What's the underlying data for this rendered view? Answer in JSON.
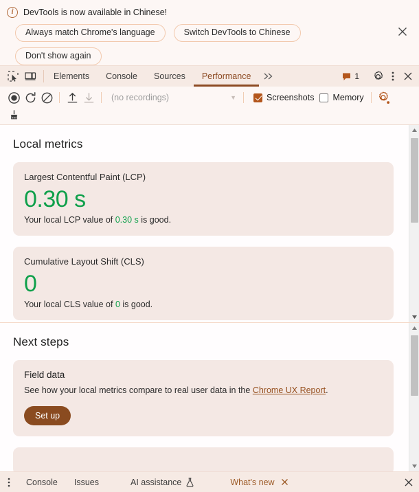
{
  "banner": {
    "icon": "info-circle-icon",
    "title": "DevTools is now available in Chinese!",
    "buttons": [
      {
        "label": "Always match Chrome's language",
        "name": "always-match-language-button"
      },
      {
        "label": "Switch DevTools to Chinese",
        "name": "switch-to-chinese-button"
      },
      {
        "label": "Don't show again",
        "name": "dont-show-again-button"
      }
    ],
    "close_icon": "close-icon"
  },
  "tabbar": {
    "inspect_icon": "inspect-element-icon",
    "device_icon": "device-toolbar-icon",
    "tabs": [
      {
        "label": "Elements",
        "active": false
      },
      {
        "label": "Console",
        "active": false
      },
      {
        "label": "Sources",
        "active": false
      },
      {
        "label": "Performance",
        "active": true
      }
    ],
    "more_tabs_icon": "chevron-double-right-icon",
    "issues": {
      "icon": "issues-flag-icon",
      "count": "1"
    },
    "settings_icon": "gear-icon",
    "menu_icon": "kebab-menu-icon",
    "close_icon": "close-icon"
  },
  "perf_toolbar": {
    "record_icon": "record-circle-icon",
    "reload_record_icon": "reload-and-record-icon",
    "clear_icon": "clear-no-entry-icon",
    "upload_icon": "upload-profile-icon",
    "download_icon": "download-profile-icon",
    "trash_icon": "broom-clear-icon",
    "recording_select": {
      "value": "(no recordings)",
      "caret": "caret-down-icon"
    },
    "screenshots": {
      "label": "Screenshots",
      "checked": true
    },
    "memory": {
      "label": "Memory",
      "checked": false
    },
    "capture_settings_icon": "capture-settings-gear-icon"
  },
  "local_metrics": {
    "title": "Local metrics",
    "cards": [
      {
        "title": "Largest Contentful Paint (LCP)",
        "value": "0.30 s",
        "desc_pre": "Your local LCP value of ",
        "desc_value": "0.30 s",
        "desc_post": " is good."
      },
      {
        "title": "Cumulative Layout Shift (CLS)",
        "value": "0",
        "desc_pre": "Your local CLS value of ",
        "desc_value": "0",
        "desc_post": " is good."
      }
    ]
  },
  "next_steps": {
    "title": "Next steps",
    "card": {
      "heading": "Field data",
      "text_pre": "See how your local metrics compare to real user data in the ",
      "link": "Chrome UX Report",
      "text_post": ".",
      "button": "Set up"
    }
  },
  "drawer": {
    "menu_icon": "kebab-menu-icon",
    "tabs": [
      {
        "label": "Console",
        "active": false,
        "icon": null,
        "closable": false
      },
      {
        "label": "Issues",
        "active": false,
        "icon": null,
        "closable": false
      },
      {
        "label": "AI assistance",
        "active": false,
        "icon": "flask-icon",
        "closable": false
      },
      {
        "label": "What's new",
        "active": true,
        "icon": null,
        "closable": true
      }
    ],
    "close_icon": "close-icon"
  },
  "colors": {
    "accent_brown": "#8a4b20",
    "tab_active": "#8c4a22",
    "good_green": "#0fa04b",
    "card_bg": "#f4e8e4",
    "chrome_bg": "#f6eae4",
    "checkbox_checked": "#b3561c",
    "link": "#96501f"
  },
  "scrollbars": {
    "top": {
      "thumb_top_pct": 6,
      "thumb_height_pct": 47
    },
    "bottom": {
      "thumb_top_pct": 2,
      "thumb_height_pct": 62
    }
  }
}
